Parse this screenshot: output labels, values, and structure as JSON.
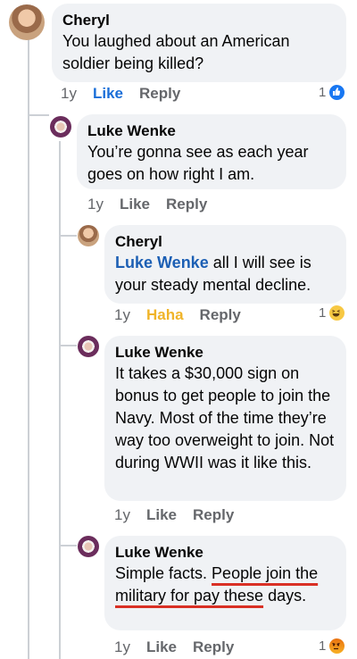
{
  "comments": [
    {
      "author": "Cheryl",
      "text": "You laughed about an American soldier being killed?",
      "time": "1y",
      "like_label": "Like",
      "reply_label": "Reply",
      "reaction_count": "1",
      "reaction_icon": "like-icon"
    },
    {
      "author": "Luke Wenke",
      "text": "You’re gonna see as each year goes on how right I am.",
      "time": "1y",
      "like_label": "Like",
      "reply_label": "Reply"
    },
    {
      "author": "Cheryl",
      "mention": "Luke Wenke",
      "text": "all I will see is your steady mental decline.",
      "time": "1y",
      "like_label": "Haha",
      "reply_label": "Reply",
      "reaction_count": "1",
      "reaction_icon": "haha-icon"
    },
    {
      "author": "Luke Wenke",
      "text": "It takes a $30,000 sign on bonus to get people to join the Navy.  Most of the time they’re way too overweight to join.  Not during WWII was it like this.",
      "time": "1y",
      "like_label": "Like",
      "reply_label": "Reply"
    },
    {
      "author": "Luke Wenke",
      "text_plain": "Simple facts.  ",
      "text_underlined": "People join the military for pay these",
      "text_tail": " days.",
      "time": "1y",
      "like_label": "Like",
      "reply_label": "Reply",
      "reaction_count": "1",
      "reaction_icon": "angry-icon"
    }
  ],
  "colors": {
    "bubble": "#f0f2f5",
    "link_blue": "#1c5fb4",
    "like_blue": "#1877f2",
    "haha_yellow": "#f0b429",
    "underline_red": "#d93025",
    "meta_gray": "#65676b"
  }
}
